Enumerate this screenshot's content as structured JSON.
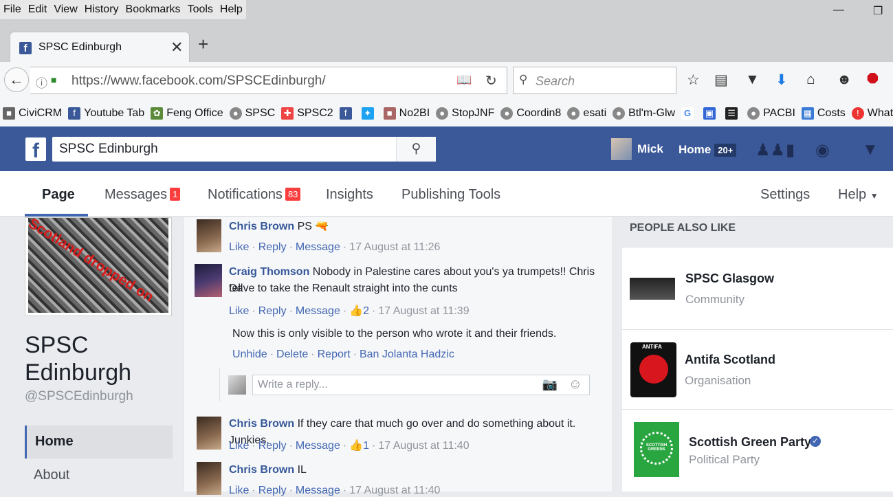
{
  "browser": {
    "menu": [
      "File",
      "Edit",
      "View",
      "History",
      "Bookmarks",
      "Tools",
      "Help"
    ],
    "tab_title": "SPSC Edinburgh",
    "url": "https://www.facebook.com/SPSCEdinburgh/",
    "search_placeholder": "Search",
    "bookmarks": [
      "CiviCRM",
      "Youtube Tab",
      "Feng Office",
      "SPSC",
      "SPSC2",
      "No2BI",
      "StopJNF",
      "Coordin8",
      "esati",
      "Btl'm-Glw",
      "PACBI",
      "Costs",
      "WhatsApp"
    ]
  },
  "fb": {
    "search_value": "SPSC Edinburgh",
    "user_name": "Mick",
    "home_label": "Home",
    "home_count": "20+"
  },
  "page_nav": {
    "page": "Page",
    "messages": "Messages",
    "messages_badge": "1",
    "notifications": "Notifications",
    "notifications_badge": "83",
    "insights": "Insights",
    "publishing_tools": "Publishing Tools",
    "settings": "Settings",
    "help": "Help"
  },
  "left": {
    "cover_text": "Scotland dropped on",
    "page_name": "SPSC Edinburgh",
    "handle": "@SPSCEdinburgh",
    "nav_home": "Home",
    "nav_about": "About"
  },
  "comments": [
    {
      "name": "Chris Brown",
      "text": "PS",
      "like": "Like",
      "reply": "Reply",
      "message": "Message",
      "time": "17 August at 11:26"
    },
    {
      "name": "Craig Thomson",
      "text": "Nobody in Palestine cares about you's ya trumpets!! Chris tell",
      "text2": "Dave to take the Renault straight into the cunts",
      "like": "Like",
      "reply": "Reply",
      "message": "Message",
      "likes": "2",
      "time": "17 August at 11:39"
    },
    {
      "name": "Chris Brown",
      "text": "If they care that much go over and do something about it. Junkies.",
      "like": "Like",
      "reply": "Reply",
      "message": "Message",
      "likes": "1",
      "time": "17 August at 11:40"
    },
    {
      "name": "Chris Brown",
      "text": "IL",
      "like": "Like",
      "reply": "Reply",
      "message": "Message",
      "time": "17 August at 11:40"
    }
  ],
  "hidden_notice": {
    "text": "Now this is only visible to the person who wrote it and their friends.",
    "unhide": "Unhide",
    "delete": "Delete",
    "report": "Report",
    "ban": "Ban Jolanta Hadzic"
  },
  "reply_placeholder": "Write a reply...",
  "people_also_like": {
    "title": "PEOPLE ALSO LIKE",
    "pages": [
      {
        "name": "SPSC Glasgow",
        "category": "Community"
      },
      {
        "name": "Antifa Scotland",
        "category": "Organisation",
        "logo_text": "ANTIFA"
      },
      {
        "name": "Scottish Green Party",
        "category": "Political Party",
        "logo_text": "SCOTTISH GREENS"
      }
    ]
  },
  "colors": {
    "fb_blue": "#3b5998",
    "link": "#365899",
    "badge_red": "#fa3e3e",
    "green_party": "#2aa640"
  }
}
